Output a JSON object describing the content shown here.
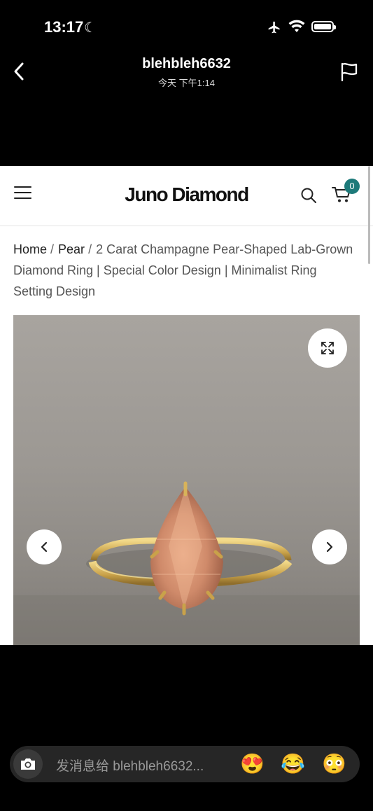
{
  "status_bar": {
    "time": "13:17"
  },
  "chat_header": {
    "username": "blehbleh6632",
    "timestamp": "今天 下午1:14"
  },
  "site": {
    "logo": "Juno Diamond",
    "cart_count": "0",
    "accent_color": "#1d7a7a"
  },
  "breadcrumb": {
    "home": "Home",
    "category": "Pear",
    "separator": "/",
    "product": "2 Carat Champagne Pear-Shaped Lab-Grown Diamond Ring | Special Color Design | Minimalist Ring Setting Design"
  },
  "gallery": {
    "image": "champagne pear-shaped diamond ring",
    "icons": [
      "expand-icon",
      "chevron-left-icon",
      "chevron-right-icon"
    ]
  },
  "message_bar": {
    "placeholder": "发消息给 blehbleh6632...",
    "emojis": [
      "😍",
      "😂",
      "😳"
    ]
  }
}
